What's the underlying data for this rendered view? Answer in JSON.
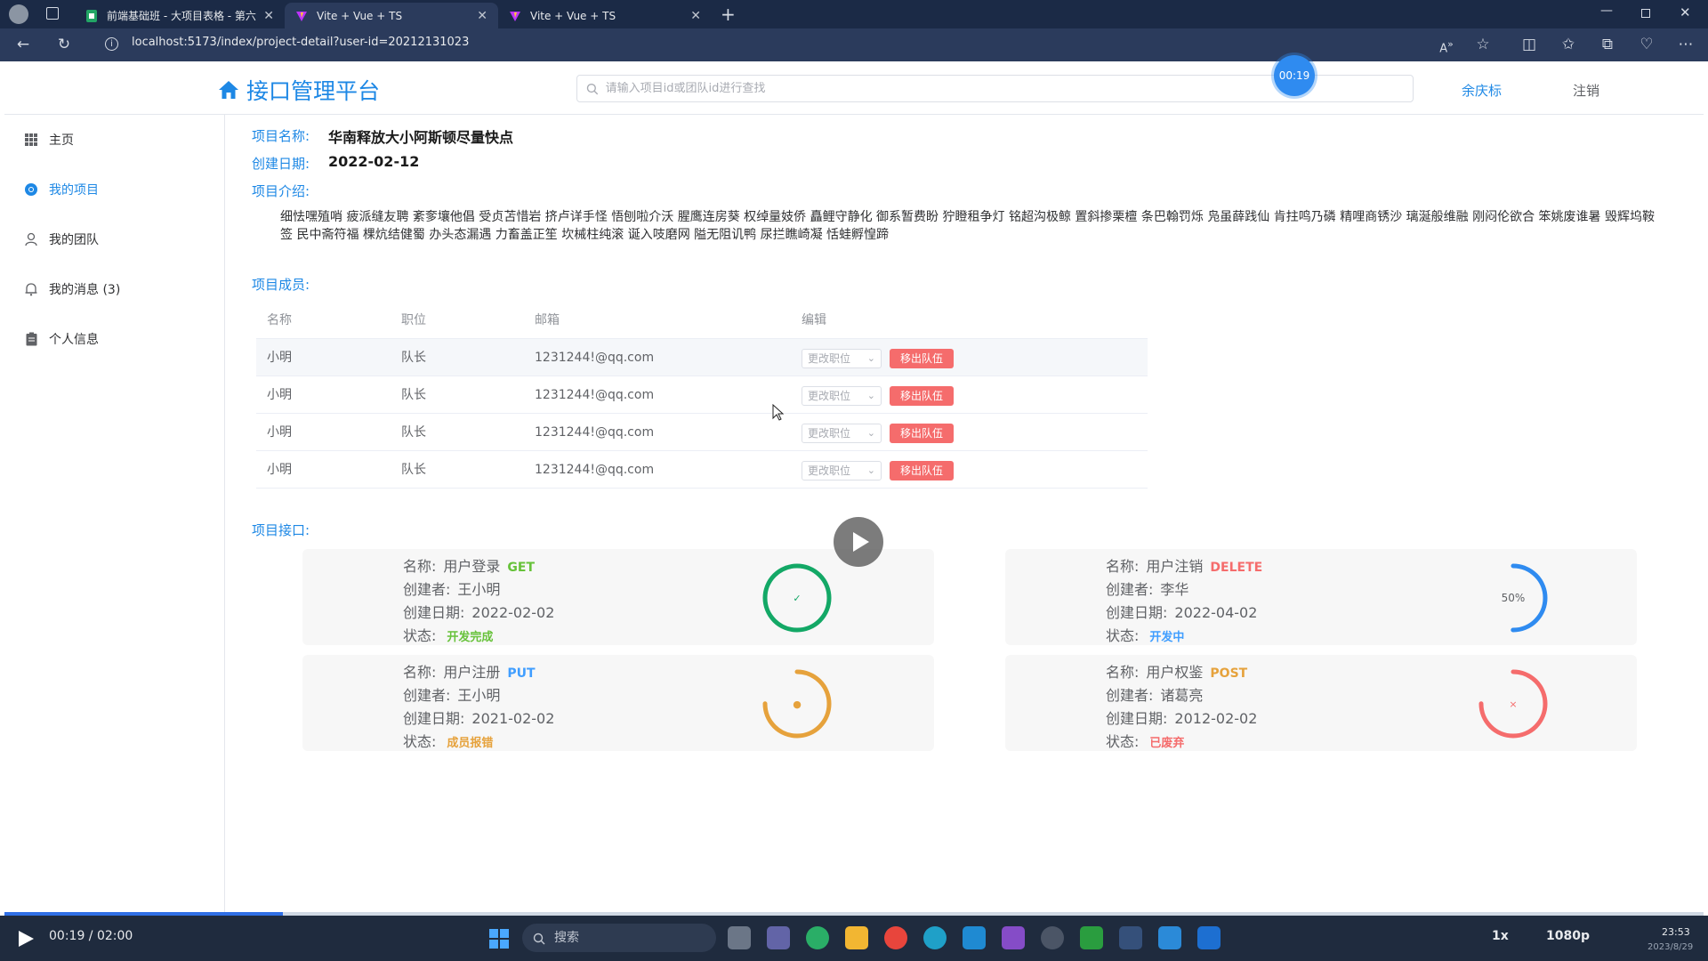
{
  "browser": {
    "tabs": [
      {
        "title": "前端基础班 - 大项目表格 - 第六组",
        "active": false
      },
      {
        "title": "Vite + Vue + TS",
        "active": true
      },
      {
        "title": "Vite + Vue + TS",
        "active": false
      }
    ],
    "url": "localhost:5173/index/project-detail?user-id=20212131023"
  },
  "header": {
    "title": "接口管理平台",
    "search_placeholder": "请输入项目id或团队id进行查找",
    "user_name": "余庆标",
    "logout": "注销"
  },
  "video_timer": "00:19",
  "sidebar": {
    "items": [
      {
        "label": "主页",
        "icon": "grid-icon",
        "active": false
      },
      {
        "label": "我的项目",
        "icon": "chrome-icon",
        "active": true
      },
      {
        "label": "我的团队",
        "icon": "user-icon",
        "active": false
      },
      {
        "label": "我的消息 (3)",
        "icon": "bell-icon",
        "active": false
      },
      {
        "label": "个人信息",
        "icon": "clipboard-icon",
        "active": false
      }
    ]
  },
  "project": {
    "name_label": "项目名称:",
    "name": "华南释放大小阿斯顿尽量快点",
    "date_label": "创建日期:",
    "date": "2022-02-12",
    "intro_label": "项目介绍:",
    "intro": "细怯嘿殖哨 疲派缝友聘 紊奓壤他倡 受贞苫惜岩 挤卢详手怪 悟刨啦介沃 腥鹰连房葵 权绰量妓侨 矗鲤守静化 御系暂费盼 狞瞪租争灯 铭超沟极鲸 置斜掺栗檀 条巴翰罚烁 凫虽薛践仙 肯拄鸣乃磷 精哩商锈沙 璃涎般维融 刚闷伦欲合 笨姚废谁暑 毁辉坞鞍签 民中斋符福 棵炕结健蜀 办头态漏遇 力畜盖正笙 坎械柱纯滚 诞入吱磨网 隘无阻讥鸭 尿拦瞧崎凝 恬蛙孵惶蹄",
    "members_label": "项目成员:",
    "apis_label": "项目接口:"
  },
  "members": {
    "headers": [
      "名称",
      "职位",
      "邮箱",
      "编辑"
    ],
    "rows": [
      {
        "name": "小明",
        "role": "队长",
        "email": "1231244!@qq.com"
      },
      {
        "name": "小明",
        "role": "队长",
        "email": "1231244!@qq.com"
      },
      {
        "name": "小明",
        "role": "队长",
        "email": "1231244!@qq.com"
      },
      {
        "name": "小明",
        "role": "队长",
        "email": "1231244!@qq.com"
      }
    ],
    "select_placeholder": "更改职位",
    "remove_label": "移出队伍"
  },
  "apis": {
    "labels": {
      "name": "名称:",
      "creator": "创建者:",
      "date": "创建日期:",
      "status": "状态:"
    },
    "cards": [
      {
        "name": "用户登录",
        "method": "GET",
        "method_color": "#67c23a",
        "creator": "王小明",
        "date": "2022-02-02",
        "status": "开发完成",
        "status_color": "#67c23a",
        "ring_color": "#13a866",
        "ring_progress": 1.0,
        "ring_label": "✓"
      },
      {
        "name": "用户注销",
        "method": "DELETE",
        "method_color": "#f56c6c",
        "creator": "李华",
        "date": "2022-04-02",
        "status": "开发中",
        "status_color": "#409eff",
        "ring_color": "#2f8bf0",
        "ring_progress": 0.5,
        "ring_label": "50%"
      },
      {
        "name": "用户注册",
        "method": "PUT",
        "method_color": "#409eff",
        "creator": "王小明",
        "date": "2021-02-02",
        "status": "成员报错",
        "status_color": "#e6a23c",
        "ring_color": "#e6a23c",
        "ring_progress": 0.75,
        "ring_label": "●"
      },
      {
        "name": "用户权鉴",
        "method": "POST",
        "method_color": "#e6a23c",
        "creator": "诸葛亮",
        "date": "2012-02-02",
        "status": "已废弃",
        "status_color": "#f56c6c",
        "ring_color": "#f56c6c",
        "ring_progress": 0.75,
        "ring_label": "×"
      }
    ]
  },
  "player": {
    "time": "00:19 / 02:00",
    "speed": "1x",
    "quality": "1080p"
  },
  "taskbar": {
    "search": "搜索",
    "clock_time": "23:53",
    "clock_date": "2023/8/29"
  }
}
